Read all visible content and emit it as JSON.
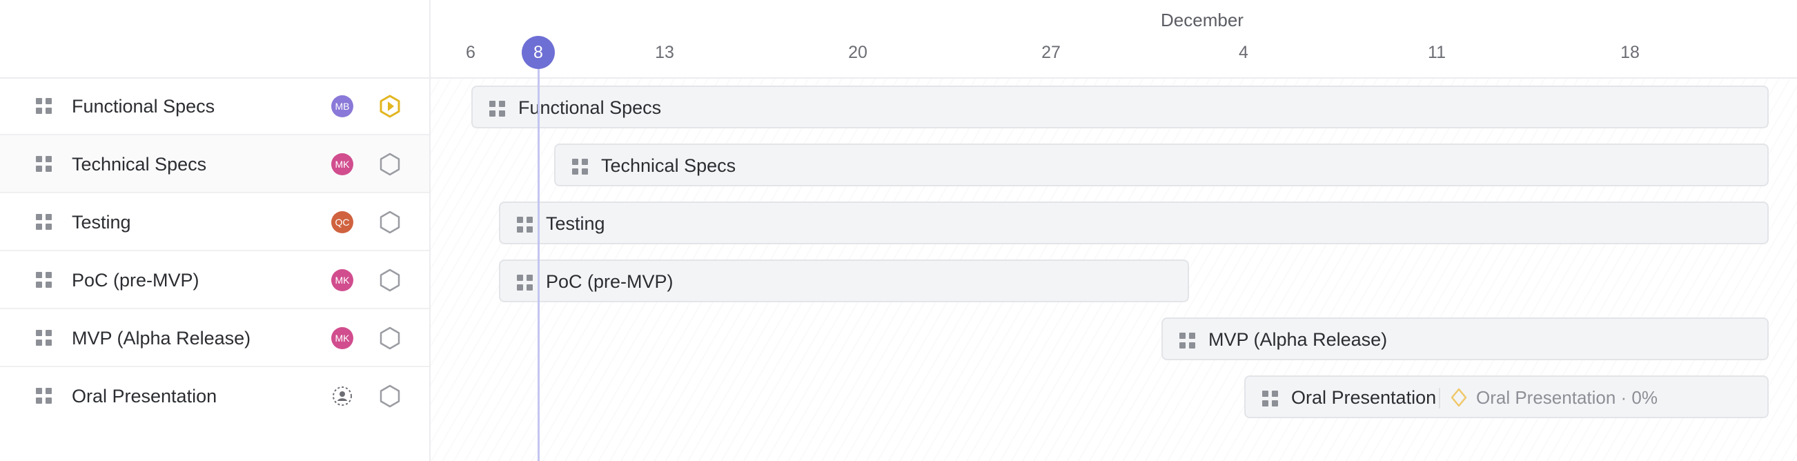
{
  "tasks": [
    {
      "name": "Functional Specs",
      "assignee": "MB",
      "avatar_color": "#8a79d8",
      "status": "in-progress"
    },
    {
      "name": "Technical Specs",
      "assignee": "MK",
      "avatar_color": "#d14d8e",
      "status": "todo"
    },
    {
      "name": "Testing",
      "assignee": "QC",
      "avatar_color": "#d0623f",
      "status": "todo"
    },
    {
      "name": "PoC (pre-MVP)",
      "assignee": "MK",
      "avatar_color": "#d14d8e",
      "status": "todo"
    },
    {
      "name": "MVP (Alpha Release)",
      "assignee": "MK",
      "avatar_color": "#d14d8e",
      "status": "todo"
    },
    {
      "name": "Oral Presentation",
      "assignee": "",
      "avatar_color": "",
      "status": "todo"
    }
  ],
  "timeline": {
    "month": "December",
    "days": [
      "6",
      "8",
      "13",
      "20",
      "27",
      "4",
      "11",
      "18"
    ],
    "today": "8"
  },
  "milestone": {
    "label": "Oral Presentation · 0%"
  },
  "colors": {
    "accent": "#6e6fd4",
    "in_progress": "#e2b51f",
    "todo": "#9a9ca2"
  }
}
